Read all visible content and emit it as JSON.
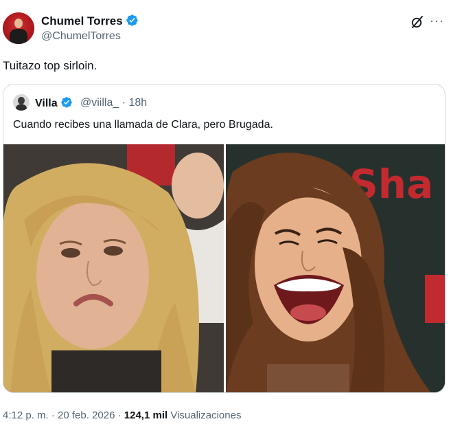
{
  "tweet": {
    "author": {
      "name": "Chumel Torres",
      "handle": "@ChumelTorres",
      "avatar_icon": "avatar-icon"
    },
    "text": "Tuitazo top sirloin.",
    "icons": {
      "grok": "grok-icon",
      "more": "more-icon"
    },
    "quoted": {
      "name": "Villa",
      "handle": "@viilla_",
      "time": "· 18h",
      "text": "Cuando recibes una llamada de Clara, pero Brugada.",
      "images": [
        {
          "name": "sad-woman-photo"
        },
        {
          "name": "laughing-woman-photo",
          "background_text": "Sha"
        }
      ]
    },
    "footer": {
      "timestamp": "4:12 p. m. · 20 feb. 2026 · ",
      "views_count": "124,1 mil",
      "views_label": " Visualizaciones"
    }
  },
  "colors": {
    "verified": "#1d9bf0",
    "secondary_text": "#536471",
    "border": "#cfd9de"
  }
}
